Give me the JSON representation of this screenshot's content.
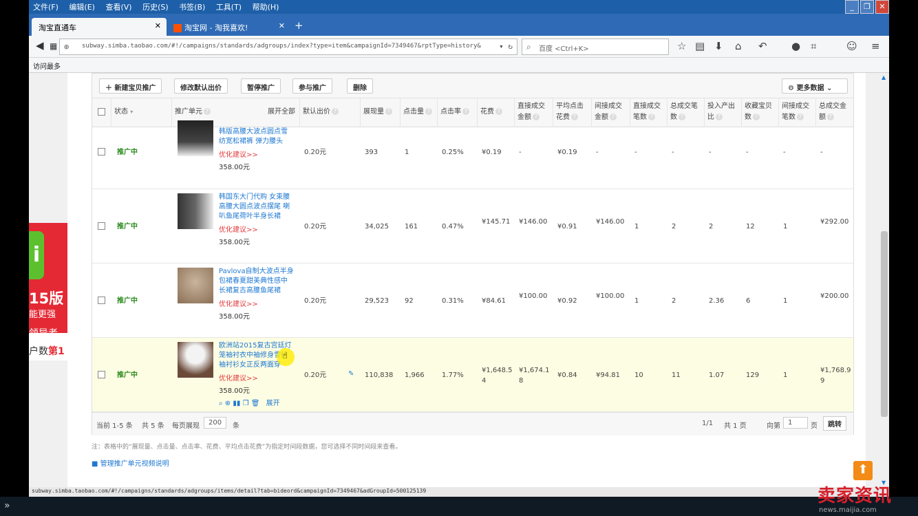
{
  "menubar": {
    "items": [
      "文件(F)",
      "编辑(E)",
      "查看(V)",
      "历史(S)",
      "书签(B)",
      "工具(T)",
      "帮助(H)"
    ]
  },
  "tabs": [
    {
      "label": "淘宝直通车",
      "active": true
    },
    {
      "label": "淘宝网 - 淘我喜欢!",
      "active": false
    }
  ],
  "address": {
    "url": "subway.simba.taobao.com/#!/campaigns/standards/adgroups/index?type=item&campaignId=7349467&rptType=history&",
    "search_placeholder": "百度 <Ctrl+K>"
  },
  "bookmarks": {
    "most_visited": "访问最多"
  },
  "left_ad": {
    "big": "15版",
    "line2": "能更强",
    "line3": "领导者",
    "line4_prefix": "户数",
    "line4_accent": "第1"
  },
  "toolbar": {
    "new_label": "新建宝贝推广",
    "edit_bid_label": "修改默认出价",
    "pause_label": "暂停推广",
    "join_label": "参与推广",
    "delete_label": "删除",
    "more_data_label": "更多数据"
  },
  "columns": {
    "status": "状态",
    "unit": "推广单元",
    "expand_all": "展开全部",
    "default_bid": "默认出价",
    "impressions": "展现量",
    "clicks": "点击量",
    "ctr": "点击率",
    "cost": "花费",
    "direct_gmv_1": "直接成交",
    "direct_gmv_2": "金额",
    "avg_cpc_1": "平均点击",
    "avg_cpc_2": "花费",
    "indirect_gmv_1": "间接成交",
    "indirect_gmv_2": "金额",
    "direct_orders_1": "直接成交",
    "direct_orders_2": "笔数",
    "total_orders_1": "总成交笔",
    "total_orders_2": "数",
    "roi_1": "投入产出",
    "roi_2": "比",
    "favorites_1": "收藏宝贝",
    "favorites_2": "数",
    "indirect_orders_1": "间接成交",
    "indirect_orders_2": "笔数",
    "total_gmv_1": "总成交金",
    "total_gmv_2": "额"
  },
  "rows": [
    {
      "status": "推广中",
      "title": [
        "韩版高腰大波点圆点雪",
        "纺宽松裙裤 弹力腰头"
      ],
      "suggest": "优化建议>>",
      "price": "358.00元",
      "bid": "0.20元",
      "impressions": "393",
      "clicks": "1",
      "ctr": "0.25%",
      "cost": "¥0.19",
      "direct_gmv": "-",
      "avg_cpc": "¥0.19",
      "indirect_gmv": "-",
      "direct_orders": "-",
      "total_orders": "-",
      "roi": "-",
      "favorites": "-",
      "indirect_orders": "-",
      "total_gmv": "-"
    },
    {
      "status": "推广中",
      "title": [
        "韩国东大门代购 女束腰",
        "高腰大圆点波点摆尾 喇",
        "叭鱼尾荷叶半身长裙"
      ],
      "suggest": "优化建议>>",
      "price": "358.00元",
      "bid": "0.20元",
      "impressions": "34,025",
      "clicks": "161",
      "ctr": "0.47%",
      "cost": "¥145.71",
      "direct_gmv": "¥146.00",
      "avg_cpc": "¥0.91",
      "indirect_gmv": "¥146.00",
      "direct_orders": "1",
      "total_orders": "2",
      "roi": "2",
      "favorites": "12",
      "indirect_orders": "1",
      "total_gmv": "¥292.00"
    },
    {
      "status": "推广中",
      "title": [
        "Pavlova自制大波点半身",
        "包裙春夏甜美典性感中",
        "长裙复古高腰鱼尾裙"
      ],
      "suggest": "优化建议>>",
      "price": "358.00元",
      "bid": "0.20元",
      "impressions": "29,523",
      "clicks": "92",
      "ctr": "0.31%",
      "cost": "¥84.61",
      "direct_gmv": "¥100.00",
      "avg_cpc": "¥0.92",
      "indirect_gmv": "¥100.00",
      "direct_orders": "1",
      "total_orders": "2",
      "roi": "2.36",
      "favorites": "6",
      "indirect_orders": "1",
      "total_gmv": "¥200.00"
    },
    {
      "status": "推广中",
      "title": [
        "欧洲站2015复古宫廷灯",
        "笼袖衬衣中袖修身雪纺",
        "袖衬衫女正反两面穿"
      ],
      "suggest": "优化建议>>",
      "price": "358.00元",
      "bid": "0.20元",
      "impressions": "110,838",
      "clicks": "1,966",
      "ctr": "1.77%",
      "cost": "¥1,648.54",
      "direct_gmv": "¥1,674.18",
      "avg_cpc": "¥0.84",
      "indirect_gmv": "¥94.81",
      "direct_orders": "10",
      "total_orders": "11",
      "roi": "1.07",
      "favorites": "129",
      "indirect_orders": "1",
      "total_gmv": "¥1,768.99",
      "expand": "展开"
    }
  ],
  "pagination": {
    "range": "当前 1-5 条",
    "total": "共 5 条",
    "per_page_label": "每页展现",
    "per_page_value": "200",
    "per_page_unit": "条",
    "pages": "1/1",
    "total_pages": "共 1 页",
    "goto_label": "向第",
    "goto_value": "1",
    "goto_unit": "页",
    "jump_label": "跳转"
  },
  "note": "注：表格中的“展现量、点击量、点击率、花费、平均点击花费”为指定时间段数据，您可选择不同时间段来查看。",
  "video_link": "管理推广单元视频说明",
  "statusbar": "subway.simba.taobao.com/#!/campaigns/standards/adgroups/items/detail?tab=bideord&campaignId=7349467&adGroupId=500125139",
  "watermark": "卖家资讯",
  "watermark_sub": "news.maijia.com"
}
